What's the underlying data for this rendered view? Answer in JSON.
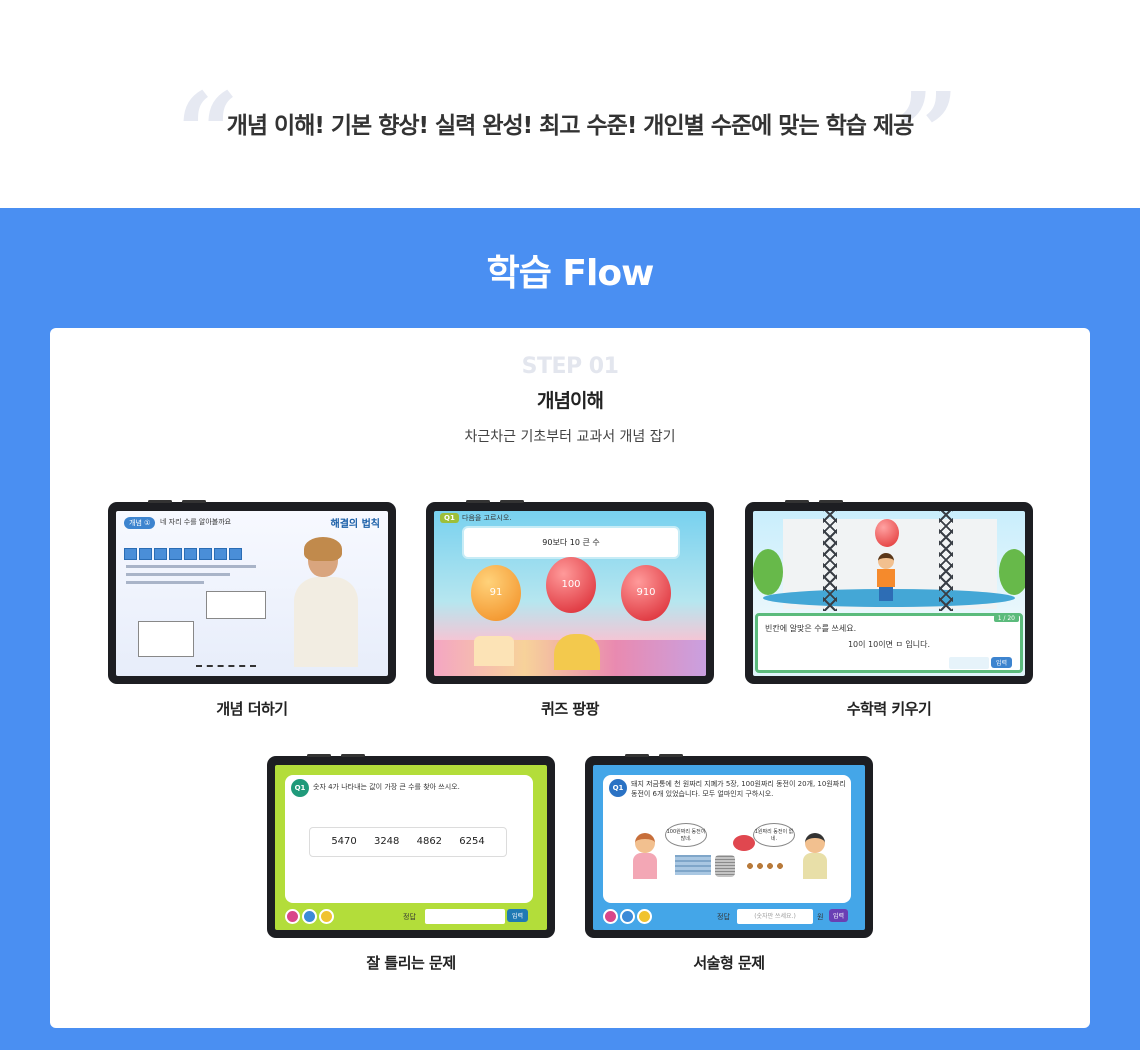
{
  "tagline": {
    "text": "개념 이해! 기본 향상! 실력 완성! 최고 수준! 개인별 수준에 맞는 학습 제공",
    "open_quote": "“",
    "close_quote": "”"
  },
  "flow": {
    "title": "학습 Flow",
    "background_color": "#4a8ff2",
    "step": {
      "label": "STEP 01",
      "title": "개념이해",
      "description": "차근차근 기초부터 교과서 개념 잡기"
    },
    "items": [
      {
        "caption": "개념 더하기",
        "screen": {
          "tag": "개념 ①",
          "tag_text": "네 자리 수를 알아볼까요",
          "brand": "해결의 법칙"
        }
      },
      {
        "caption": "퀴즈 팡팡",
        "screen": {
          "q_label": "Q1",
          "instruction": "다음을 고르시오.",
          "question": "90보다 10 큰 수",
          "options": [
            "91",
            "100",
            "910"
          ]
        }
      },
      {
        "caption": "수학력 키우기",
        "screen": {
          "counter": "1 / 20",
          "instruction": "빈칸에 알맞은 수를 쓰세요.",
          "question": "10이 10이면 ㅁ 입니다.",
          "submit_label": "입력"
        }
      },
      {
        "caption": "잘 틀리는 문제",
        "screen": {
          "q_label": "Q1",
          "question": "숫자 4가 나타내는 값이 가장 큰 수를 찾아 쓰시오.",
          "numbers": [
            "5470",
            "3248",
            "4862",
            "6254"
          ],
          "answer_label": "정답",
          "submit_label": "입력"
        }
      },
      {
        "caption": "서술형 문제",
        "screen": {
          "q_label": "Q1",
          "question": "돼지 저금통에 천 원짜리 지폐가 5장, 100원짜리 동전이 20개, 10원짜리 동전이 6개 있었습니다. 모두 얼마인지 구하시오.",
          "bubble_left": "100원짜리 동전이 많네.",
          "bubble_right": "1원짜리 동전이 없네.",
          "answer_label": "정답",
          "answer_placeholder": "(숫자만 쓰세요.)",
          "unit": "원",
          "submit_label": "입력"
        }
      }
    ]
  }
}
